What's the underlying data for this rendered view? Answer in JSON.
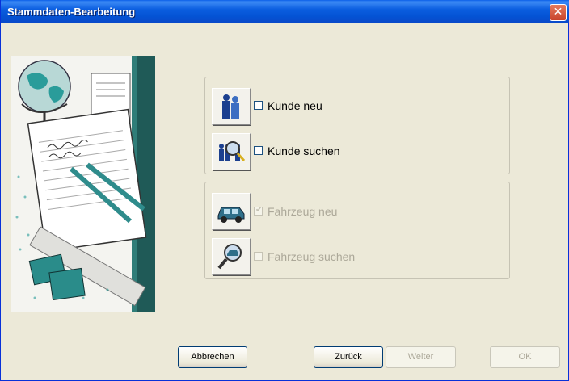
{
  "window": {
    "title": "Stammdaten-Bearbeitung"
  },
  "customer_group": {
    "options": [
      {
        "label": "Kunde neu",
        "checked": false,
        "enabled": true,
        "icon": "people-icon"
      },
      {
        "label": "Kunde suchen",
        "checked": false,
        "enabled": true,
        "icon": "people-search-icon"
      }
    ]
  },
  "vehicle_group": {
    "options": [
      {
        "label": "Fahrzeug neu",
        "checked": true,
        "enabled": false,
        "icon": "car-icon"
      },
      {
        "label": "Fahrzeug suchen",
        "checked": false,
        "enabled": false,
        "icon": "car-search-icon"
      }
    ]
  },
  "buttons": {
    "cancel": "Abbrechen",
    "back": "Zurück",
    "next": "Weiter",
    "ok": "OK"
  },
  "colors": {
    "titlebar": "#0a5fe8",
    "close": "#c8432a",
    "accent_teal": "#2f8c8c",
    "panel": "#ece9d8"
  }
}
